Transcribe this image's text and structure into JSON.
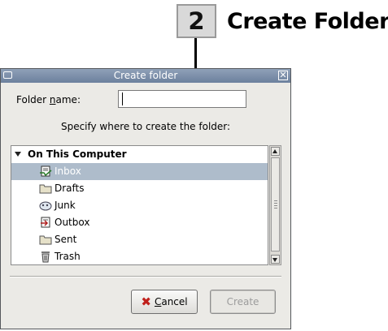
{
  "step": {
    "number": "2",
    "title": "Create Folder"
  },
  "window": {
    "title": "Create folder",
    "close_glyph": "✕"
  },
  "form": {
    "folder_name_label_pre": "Folder ",
    "folder_name_label_mnemonic": "n",
    "folder_name_label_post": "ame:",
    "folder_name_value": "",
    "specify_text": "Specify where to create the folder:"
  },
  "tree": {
    "root_label": "On This Computer",
    "items": [
      {
        "label": "Inbox",
        "icon": "inbox-icon",
        "selected": true
      },
      {
        "label": "Drafts",
        "icon": "folder-icon",
        "selected": false
      },
      {
        "label": "Junk",
        "icon": "junk-icon",
        "selected": false
      },
      {
        "label": "Outbox",
        "icon": "outbox-icon",
        "selected": false
      },
      {
        "label": "Sent",
        "icon": "folder-icon",
        "selected": false
      },
      {
        "label": "Trash",
        "icon": "trash-icon",
        "selected": false
      }
    ]
  },
  "buttons": {
    "cancel_mnemonic": "C",
    "cancel_rest": "ancel",
    "cancel_icon": "cancel-x-icon",
    "cancel_glyph": "✖",
    "create_label": "Create",
    "create_enabled": false
  },
  "colors": {
    "titlebar": "#7a8ca8",
    "selection": "#aebccb",
    "cancel_icon": "#c0201c"
  }
}
